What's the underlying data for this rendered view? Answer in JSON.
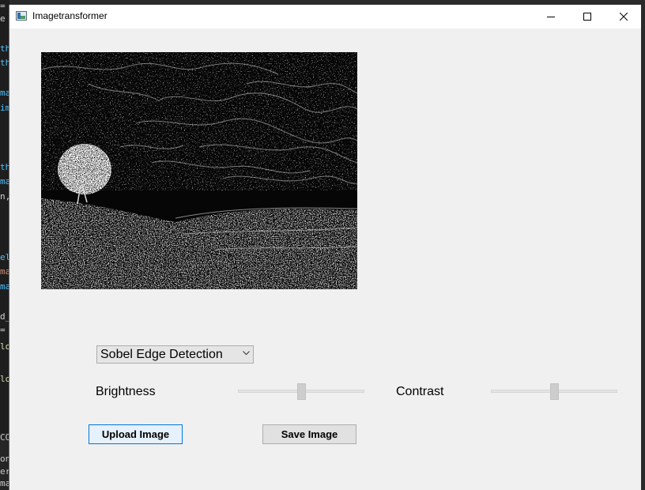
{
  "window": {
    "title": "Imagetransformer",
    "controls": {
      "minimize_icon": "minimize-icon",
      "maximize_icon": "maximize-icon",
      "close_icon": "close-icon"
    }
  },
  "preview": {
    "description_icon": "sobel-edge-image"
  },
  "controls": {
    "filter_select": {
      "selected": "Sobel Edge Detection"
    },
    "brightness": {
      "label": "Brightness",
      "level": 0.5
    },
    "contrast": {
      "label": "Contrast",
      "level": 0.5
    },
    "upload_button": {
      "label": "Upload Image"
    },
    "save_button": {
      "label": "Save Image"
    }
  },
  "background_editor": {
    "lines": [
      {
        "text": "=",
        "color": "#d4d4d4"
      },
      {
        "text": "e",
        "color": "#d4d4d4"
      },
      {
        "text": "th",
        "color": "#4fc1ff"
      },
      {
        "text": "th",
        "color": "#4fc1ff"
      },
      {
        "text": "ma",
        "color": "#4fc1ff"
      },
      {
        "text": "im",
        "color": "#4fc1ff"
      },
      {
        "text": "th",
        "color": "#4fc1ff"
      },
      {
        "text": "ma",
        "color": "#4fc1ff"
      },
      {
        "text": "n,",
        "color": "#d4d4d4"
      },
      {
        "text": "el",
        "color": "#4fc1ff"
      },
      {
        "text": "ma",
        "color": "#ce9178"
      },
      {
        "text": "ma",
        "color": "#4fc1ff"
      },
      {
        "text": "d_",
        "color": "#d4d4d4"
      },
      {
        "text": "=",
        "color": "#d4d4d4"
      },
      {
        "text": "lo",
        "color": "#dcdcaa"
      },
      {
        "text": "lo",
        "color": "#dcdcaa"
      },
      {
        "text": "CO",
        "color": "#cccccc"
      },
      {
        "text": "on",
        "color": "#cccccc"
      },
      {
        "text": "er",
        "color": "#cccccc"
      },
      {
        "text": "ma",
        "color": "#cccccc"
      }
    ]
  }
}
